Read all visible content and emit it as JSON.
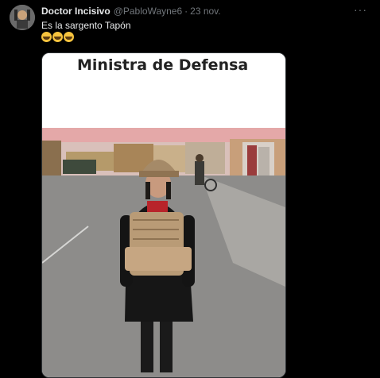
{
  "tweet": {
    "display_name": "Doctor Incisivo",
    "handle": "@PabloWayne6",
    "separator": "·",
    "date": "23 nov.",
    "text": "Es la sargento Tapón",
    "emojis": [
      "rolling-on-floor-laughing-emoji",
      "rolling-on-floor-laughing-emoji",
      "rolling-on-floor-laughing-emoji"
    ],
    "more_label": "···"
  },
  "media": {
    "caption_title": "Ministra de Defensa"
  },
  "colors": {
    "background": "#000000",
    "text_primary": "#e7e9ea",
    "text_secondary": "#71767b"
  }
}
